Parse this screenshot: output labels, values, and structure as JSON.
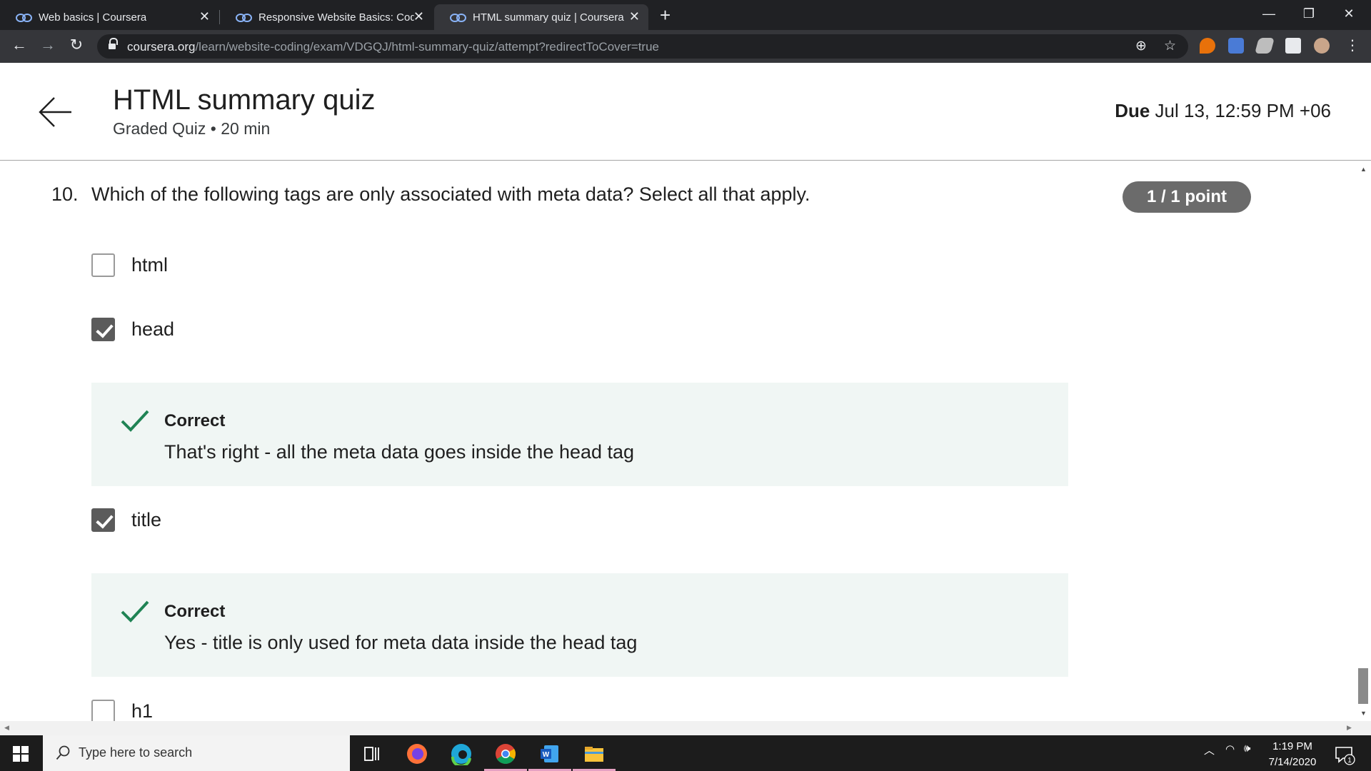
{
  "browser": {
    "tabs": [
      {
        "title": "Web basics | Coursera"
      },
      {
        "title": "Responsive Website Basics: Code"
      },
      {
        "title": "HTML summary quiz | Coursera"
      }
    ],
    "url_host": "coursera.org",
    "url_path": "/learn/website-coding/exam/VDGQJ/html-summary-quiz/attempt?redirectToCover=true"
  },
  "header": {
    "title": "HTML summary quiz",
    "subtitle": "Graded Quiz • 20 min",
    "due_label": "Due",
    "due_value": "Jul 13, 12:59 PM +06"
  },
  "question": {
    "number": "10.",
    "text": "Which of the following tags are only associated with meta data? Select all that apply.",
    "points": "1 / 1 point",
    "options": [
      {
        "label": "html",
        "checked": false
      },
      {
        "label": "head",
        "checked": true
      },
      {
        "label": "title",
        "checked": true
      },
      {
        "label": "h1",
        "checked": false
      }
    ],
    "feedback": [
      {
        "title": "Correct",
        "text": "That's right - all the meta data goes inside the head tag"
      },
      {
        "title": "Correct",
        "text": "Yes - title is only used for meta data inside the head tag"
      }
    ]
  },
  "taskbar": {
    "search_placeholder": "Type here to search",
    "time": "1:19 PM",
    "date": "7/14/2020",
    "notification_count": "1"
  },
  "colors": {
    "correct_green": "#1f8354",
    "feedback_bg": "#f0f6f4",
    "points_pill": "#6b6b6b"
  }
}
